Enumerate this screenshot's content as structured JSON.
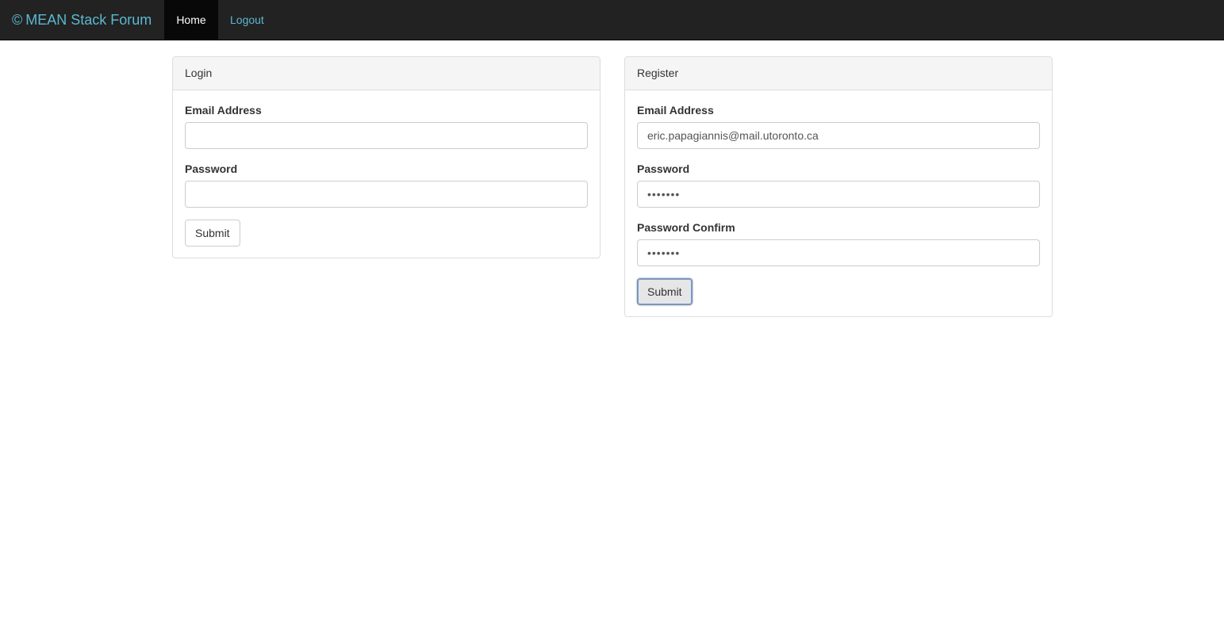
{
  "navbar": {
    "brand_icon": "©",
    "brand_label": "MEAN Stack Forum",
    "brand_color": "#5bb8d1",
    "items": [
      {
        "label": "Home",
        "active": true
      },
      {
        "label": "Logout",
        "active": false
      }
    ]
  },
  "login": {
    "title": "Login",
    "email_label": "Email Address",
    "email_value": "",
    "password_label": "Password",
    "password_value": "",
    "submit_label": "Submit"
  },
  "register": {
    "title": "Register",
    "email_label": "Email Address",
    "email_value": "eric.papagiannis@mail.utoronto.ca",
    "password_label": "Password",
    "password_value": "•••••••",
    "password_confirm_label": "Password Confirm",
    "password_confirm_value": "•••••••",
    "submit_label": "Submit"
  }
}
